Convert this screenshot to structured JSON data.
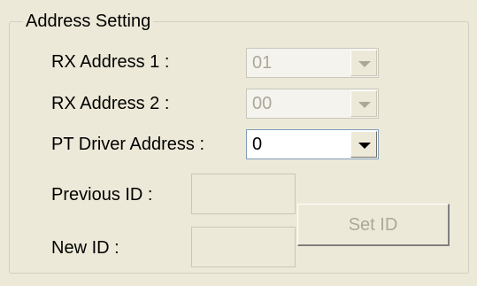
{
  "group": {
    "title": "Address Setting"
  },
  "rx1": {
    "label": "RX Address 1 :",
    "value": "01",
    "enabled": false
  },
  "rx2": {
    "label": "RX Address 2 :",
    "value": "00",
    "enabled": false
  },
  "pt": {
    "label": "PT Driver Address  :",
    "value": "0",
    "enabled": true
  },
  "previous_id": {
    "label": "Previous ID :",
    "value": ""
  },
  "new_id": {
    "label": "New ID :",
    "value": ""
  },
  "set_id": {
    "label": "Set ID",
    "enabled": false
  },
  "icons": {
    "dropdown": "chevron-down-icon"
  },
  "colors": {
    "background": "#ECE9D8",
    "disabled_text": "#ACA899",
    "field_border": "#7F9DB9"
  }
}
